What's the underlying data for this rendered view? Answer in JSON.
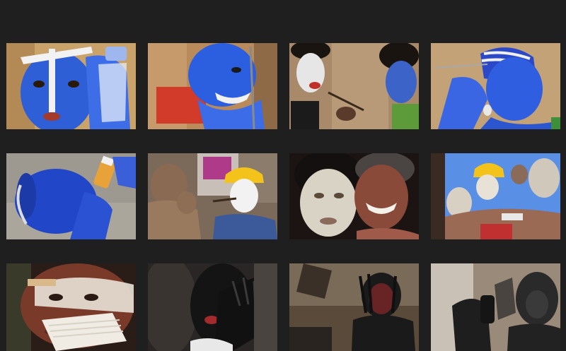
{
  "gallery": {
    "background": "#1f1f1f",
    "thumbnails": [
      {
        "icon": "blue-painted-face-photo",
        "palette": {
          "bg": "#c9a36a",
          "main": "#2f5fd6",
          "accent": "#f2f2f2"
        }
      },
      {
        "icon": "blue-painted-smile-photo",
        "palette": {
          "bg": "#b98a5a",
          "main": "#2c5fe0",
          "accent": "#d23a2a"
        }
      },
      {
        "icon": "face-painting-pair-photo",
        "palette": {
          "bg": "#a88a6a",
          "main": "#3c64c8",
          "accent": "#e6e6e6"
        }
      },
      {
        "icon": "blue-hair-profile-photo",
        "palette": {
          "bg": "#c2a276",
          "main": "#2f5fe0",
          "accent": "#f0f0f0"
        }
      },
      {
        "icon": "blue-head-drinking-photo",
        "palette": {
          "bg": "#9d9890",
          "main": "#2246c8",
          "accent": "#e8a23a"
        }
      },
      {
        "icon": "yellow-helmet-street-photo",
        "palette": {
          "bg": "#7b6a5a",
          "main": "#f3c31b",
          "accent": "#3c5a9a"
        }
      },
      {
        "icon": "white-painted-embrace-photo",
        "palette": {
          "bg": "#1b1413",
          "main": "#d9d3c5",
          "accent": "#8a4a3a"
        }
      },
      {
        "icon": "helmet-crowd-sky-photo",
        "palette": {
          "bg": "#5a8fe6",
          "main": "#f3c31b",
          "accent": "#cfc8bb"
        }
      },
      {
        "icon": "white-brush-face-photo",
        "palette": {
          "bg": "#2a1c17",
          "main": "#e9e3d8",
          "accent": "#7a3a2a"
        }
      },
      {
        "icon": "black-painted-hand-photo",
        "palette": {
          "bg": "#2a2626",
          "main": "#111111",
          "accent": "#a32b2b"
        }
      },
      {
        "icon": "black-painted-figure-photo",
        "palette": {
          "bg": "#5a4a3a",
          "main": "#1a1a1a",
          "accent": "#8a2a2a"
        }
      },
      {
        "icon": "black-painted-two-photo",
        "palette": {
          "bg": "#9a8a7a",
          "main": "#2a2a2a",
          "accent": "#c9c1b5"
        }
      }
    ]
  }
}
